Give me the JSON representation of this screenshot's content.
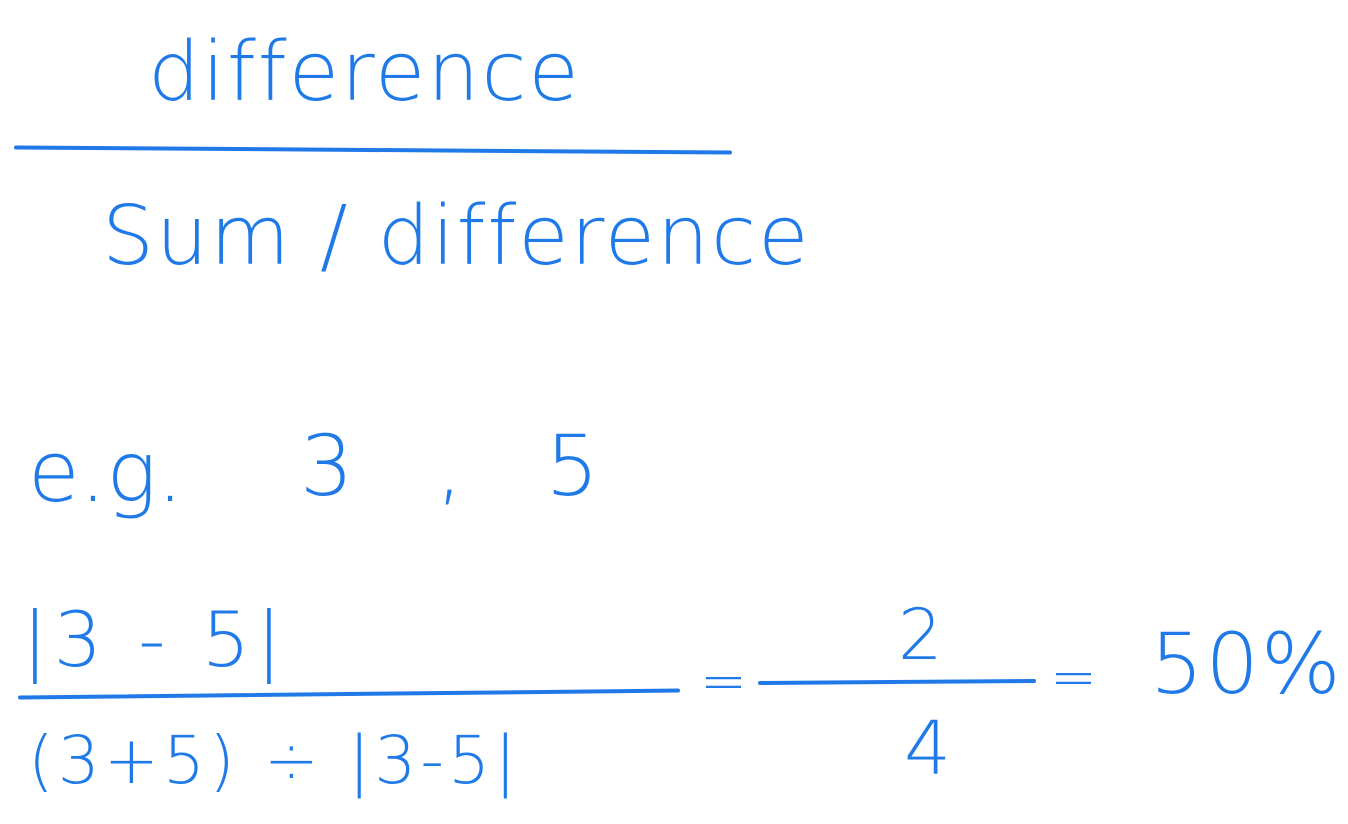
{
  "ink_color": "#1f7ae8",
  "note": {
    "formula": {
      "numerator": "difference",
      "denominator": "Sum / difference"
    },
    "example": {
      "label": "e.g.",
      "values": "3 , 5"
    },
    "calculation": {
      "numerator": "|3 - 5|",
      "denominator": "(3+5) ÷ |3-5|",
      "equals_1": "=",
      "result_numerator": "2",
      "result_denominator": "4",
      "equals_2": "=",
      "percent": "50%"
    }
  }
}
